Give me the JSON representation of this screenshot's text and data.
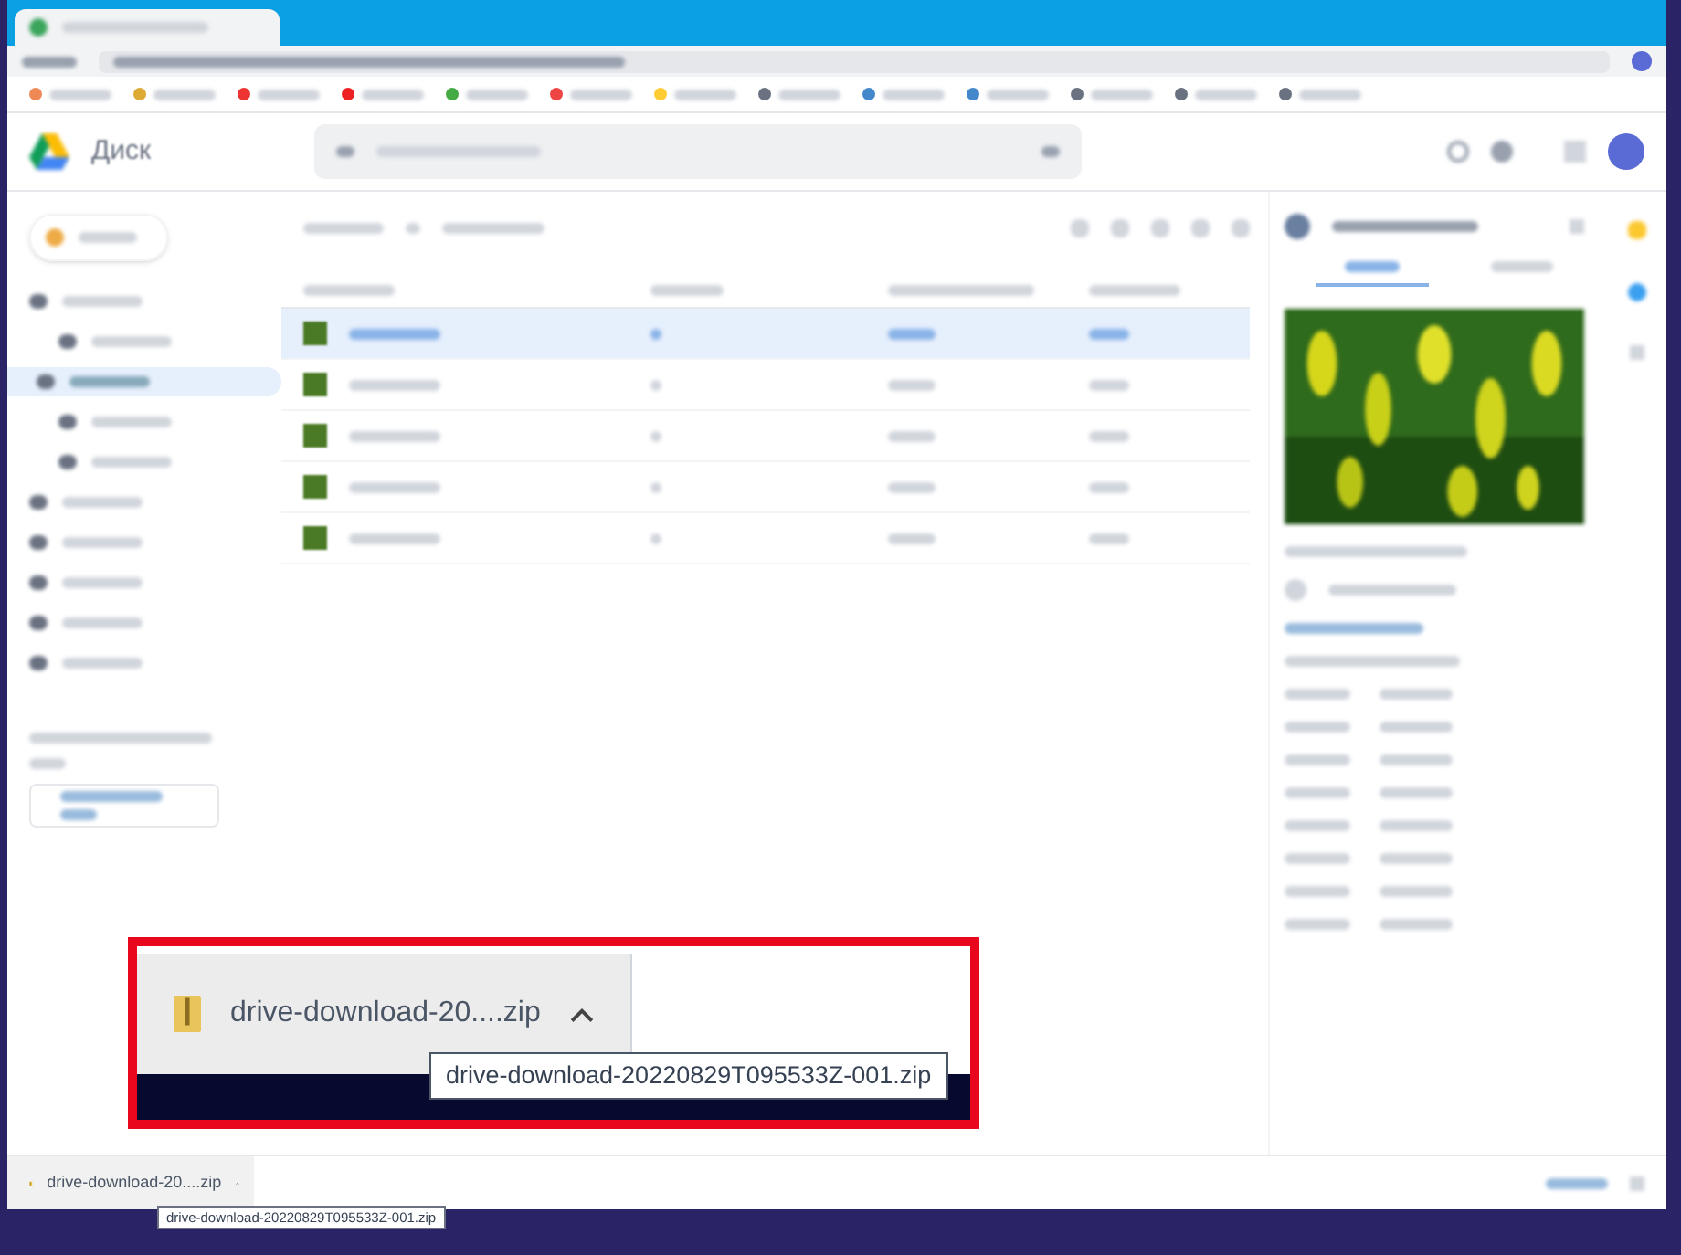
{
  "app": {
    "logo_text": "Диск"
  },
  "sidebar_items": [
    {
      "selected": false
    },
    {
      "selected": false
    },
    {
      "selected": true
    },
    {
      "selected": false
    },
    {
      "selected": false
    },
    {
      "selected": false
    },
    {
      "selected": false
    },
    {
      "selected": false
    },
    {
      "selected": false
    },
    {
      "selected": false
    }
  ],
  "file_rows": [
    {
      "selected": true
    },
    {
      "selected": false
    },
    {
      "selected": false
    },
    {
      "selected": false
    },
    {
      "selected": false
    }
  ],
  "magnified_inset": {
    "filename": "drive-download-20....zip",
    "tooltip": "drive-download-20220829T095533Z-001.zip"
  },
  "downloads_bar": {
    "filename": "drive-download-20....zip",
    "tooltip": "drive-download-20220829T095533Z-001.zip"
  }
}
